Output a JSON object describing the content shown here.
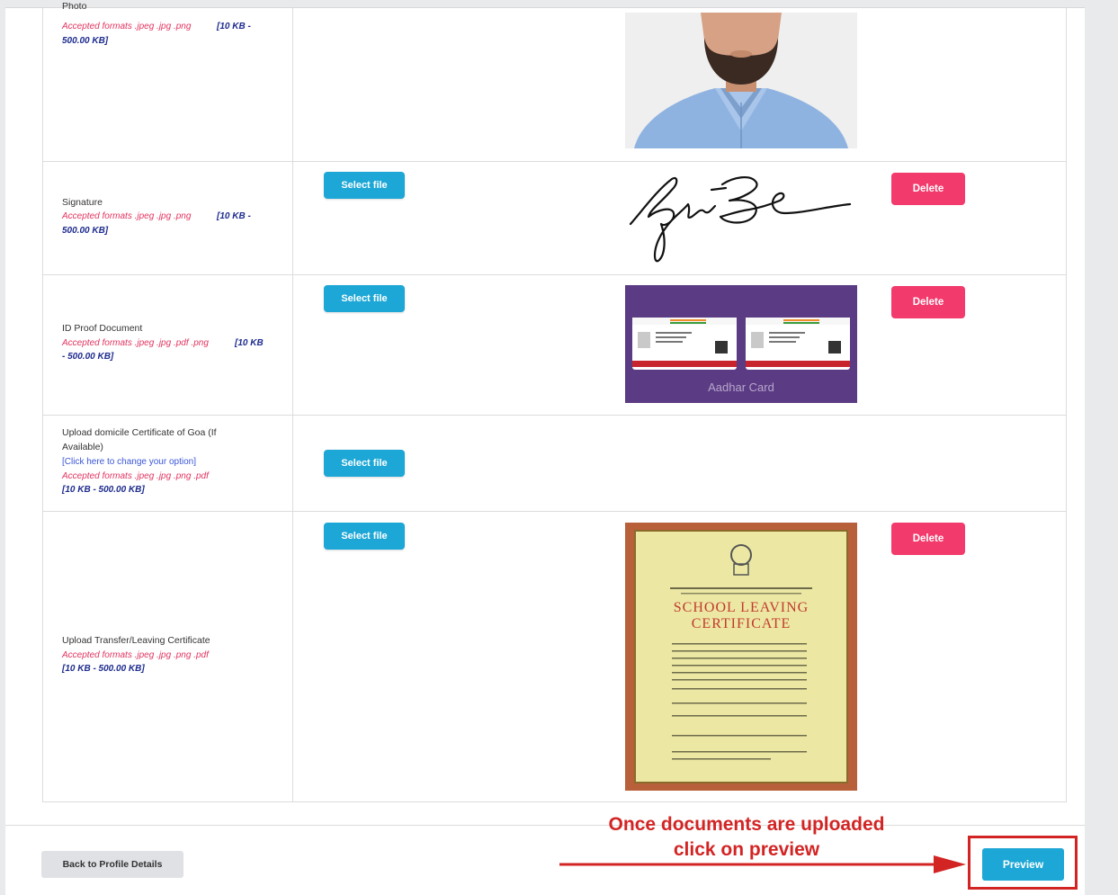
{
  "rows": {
    "photo": {
      "label": "Photo",
      "formats": "Accepted formats .jpeg .jpg .png",
      "size_a": "[10 KB -",
      "size_b": "500.00 KB]"
    },
    "signature": {
      "label": "Signature",
      "formats": "Accepted formats .jpeg .jpg .png",
      "size_a": "[10 KB -",
      "size_b": "500.00 KB]",
      "select_label": "Select file",
      "delete_label": "Delete"
    },
    "id_proof": {
      "label": "ID Proof Document",
      "formats": "Accepted formats .jpeg .jpg .pdf .png",
      "size_a": "[10 KB",
      "size_b": "- 500.00 KB]",
      "select_label": "Select file",
      "delete_label": "Delete",
      "card_caption": "Aadhar Card"
    },
    "domicile": {
      "label_line1": "Upload domicile Certificate of Goa (If",
      "label_line2": "Available)",
      "change_link": "[Click here to change your option]",
      "formats": "Accepted formats .jpeg .jpg .png .pdf",
      "size": "[10 KB - 500.00 KB]",
      "select_label": "Select file"
    },
    "transfer": {
      "label": "Upload Transfer/Leaving Certificate",
      "formats": "Accepted formats .jpeg .jpg .png .pdf",
      "size": "[10 KB - 500.00 KB]",
      "select_label": "Select file",
      "delete_label": "Delete",
      "cert_title_1": "SCHOOL LEAVING",
      "cert_title_2": "CERTIFICATE"
    }
  },
  "footer": {
    "back_label": "Back to Profile Details",
    "preview_label": "Preview"
  },
  "annotation": {
    "line1": "Once documents are uploaded",
    "line2": "click on preview"
  },
  "colors": {
    "primary": "#1da7d6",
    "danger": "#f23a6c",
    "annotation": "#d32424"
  }
}
